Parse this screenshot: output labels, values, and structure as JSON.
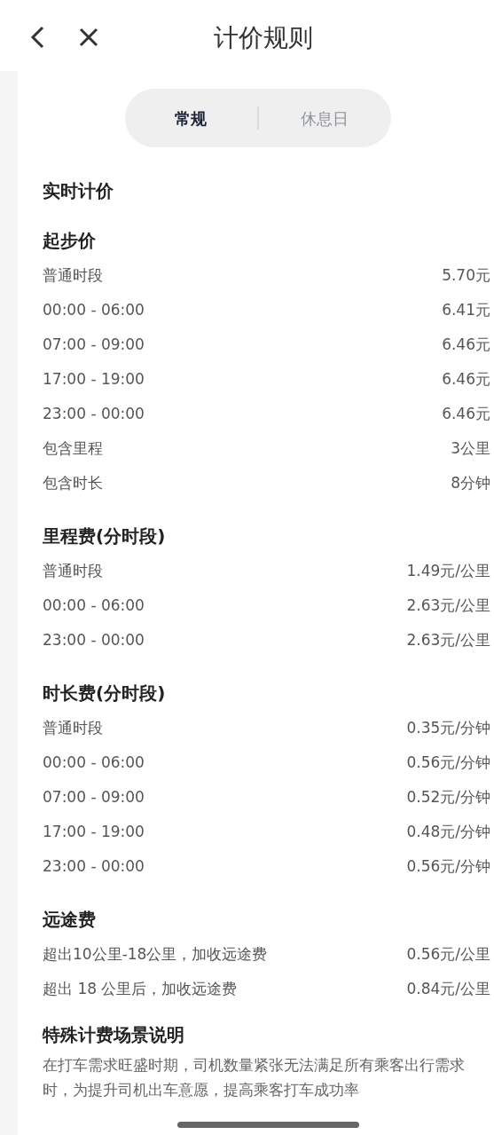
{
  "title": "计价规则",
  "tabs": [
    {
      "label": "常规",
      "selected": true
    },
    {
      "label": "休息日",
      "selected": false
    }
  ],
  "heading": "实时计价",
  "sections": [
    {
      "title": "起步价",
      "rows": [
        {
          "label": "普通时段",
          "value": "5.70元"
        },
        {
          "label": "00:00 - 06:00",
          "value": "6.41元"
        },
        {
          "label": "07:00 - 09:00",
          "value": "6.46元"
        },
        {
          "label": "17:00 - 19:00",
          "value": "6.46元"
        },
        {
          "label": "23:00 - 00:00",
          "value": "6.46元"
        },
        {
          "label": "包含里程",
          "value": "3公里"
        },
        {
          "label": "包含时长",
          "value": "8分钟"
        }
      ]
    },
    {
      "title": "里程费(分时段)",
      "rows": [
        {
          "label": "普通时段",
          "value": "1.49元/公里"
        },
        {
          "label": "00:00 - 06:00",
          "value": "2.63元/公里"
        },
        {
          "label": "23:00 - 00:00",
          "value": "2.63元/公里"
        }
      ]
    },
    {
      "title": "时长费(分时段)",
      "rows": [
        {
          "label": "普通时段",
          "value": "0.35元/分钟"
        },
        {
          "label": "00:00 - 06:00",
          "value": "0.56元/分钟"
        },
        {
          "label": "07:00 - 09:00",
          "value": "0.52元/分钟"
        },
        {
          "label": "17:00 - 19:00",
          "value": "0.48元/分钟"
        },
        {
          "label": "23:00 - 00:00",
          "value": "0.56元/分钟"
        }
      ]
    },
    {
      "title": "远途费",
      "rows": [
        {
          "label": "超出10公里-18公里，加收远途费",
          "value": "0.56元/公里"
        },
        {
          "label": "超出 18 公里后，加收远途费",
          "value": "0.84元/公里"
        }
      ]
    }
  ],
  "special": {
    "title": "特殊计费场景说明",
    "text": "在打车需求旺盛时期，司机数量紧张无法满足所有乘客出行需求时，为提升司机出车意愿，提高乘客打车成功率"
  }
}
